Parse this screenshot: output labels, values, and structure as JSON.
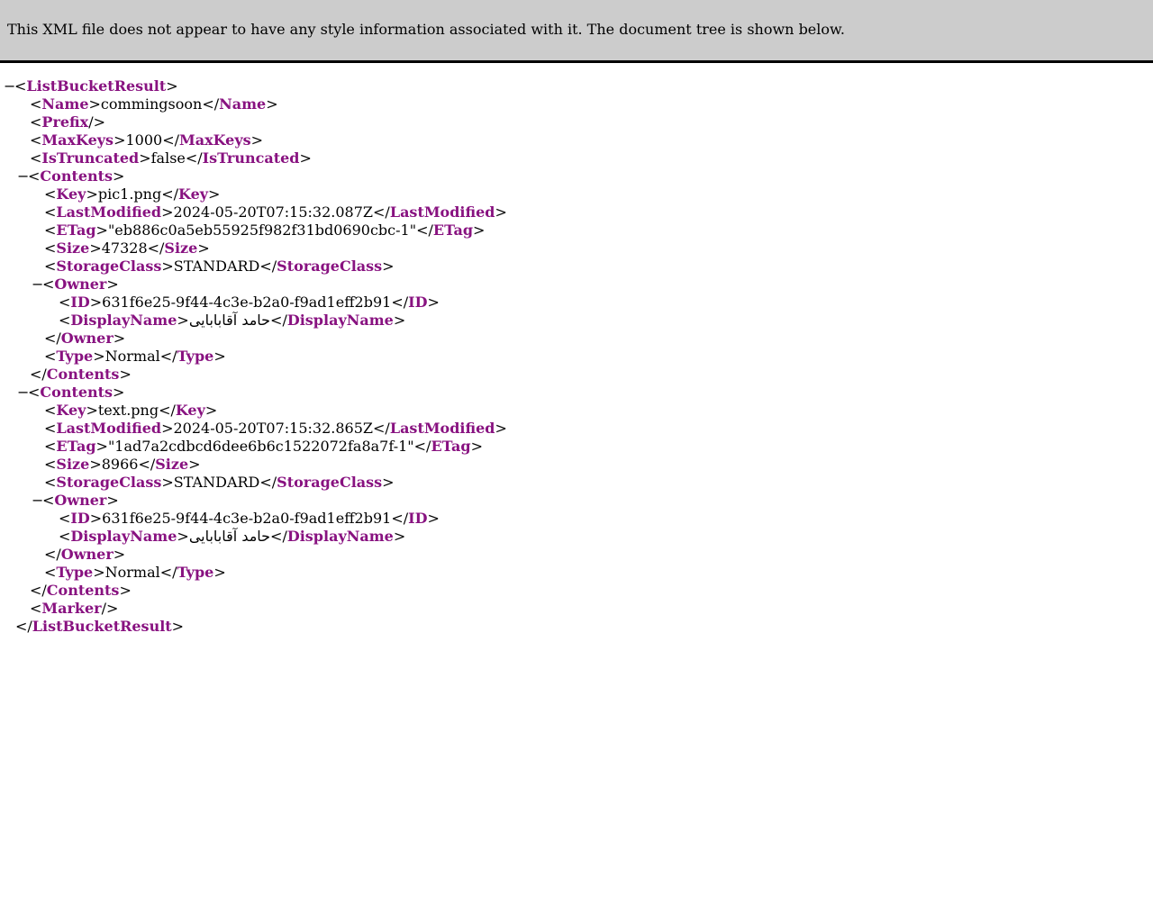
{
  "banner": {
    "message": "This XML file does not appear to have any style information associated with it. The document tree is shown below."
  },
  "tree": {
    "toggle_symbol": "−",
    "root_tag": "ListBucketResult",
    "name_tag": "Name",
    "name_value": "commingsoon",
    "prefix_tag": "Prefix",
    "maxkeys_tag": "MaxKeys",
    "maxkeys_value": "1000",
    "istruncated_tag": "IsTruncated",
    "istruncated_value": "false",
    "contents_tag": "Contents",
    "key_tag": "Key",
    "lastmodified_tag": "LastModified",
    "etag_tag": "ETag",
    "size_tag": "Size",
    "storageclass_tag": "StorageClass",
    "owner_tag": "Owner",
    "id_tag": "ID",
    "displayname_tag": "DisplayName",
    "type_tag": "Type",
    "marker_tag": "Marker",
    "contents": [
      {
        "key": "pic1.png",
        "last_modified": "2024-05-20T07:15:32.087Z",
        "etag": "\"eb886c0a5eb55925f982f31bd0690cbc-1\"",
        "size": "47328",
        "storage_class": "STANDARD",
        "owner_id": "631f6e25-9f44-4c3e-b2a0-f9ad1eff2b91",
        "owner_display_name": "حامد آقابابایی",
        "type": "Normal"
      },
      {
        "key": "text.png",
        "last_modified": "2024-05-20T07:15:32.865Z",
        "etag": "\"1ad7a2cdbcd6dee6b6c1522072fa8a7f-1\"",
        "size": "8966",
        "storage_class": "STANDARD",
        "owner_id": "631f6e25-9f44-4c3e-b2a0-f9ad1eff2b91",
        "owner_display_name": "حامد آقابابایی",
        "type": "Normal"
      }
    ]
  }
}
